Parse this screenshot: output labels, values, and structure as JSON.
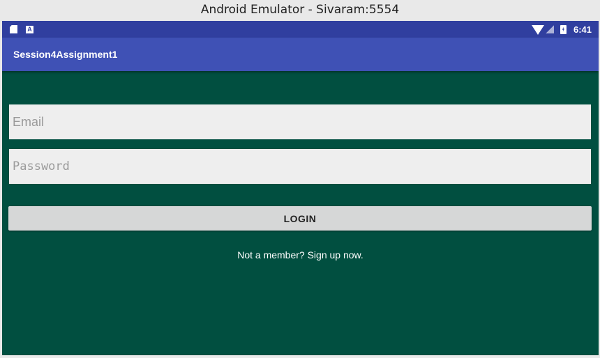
{
  "window": {
    "title": "Android Emulator - Sivaram:5554"
  },
  "statusbar": {
    "time": "6:41",
    "icons": [
      "sd-card-icon",
      "a-notification-icon",
      "wifi-icon",
      "signal-icon",
      "battery-charging-icon"
    ],
    "a_icon_letter": "A"
  },
  "appbar": {
    "title": "Session4Assignment1"
  },
  "form": {
    "email_placeholder": "Email",
    "password_placeholder": "Password",
    "login_label": "LOGIN",
    "signup_text": "Not a member? Sign up now."
  },
  "colors": {
    "background": "#014f40",
    "status_bar": "#303f9f",
    "app_bar": "#3f51b5",
    "field": "#eeeeee",
    "button": "#d6d7d7"
  }
}
